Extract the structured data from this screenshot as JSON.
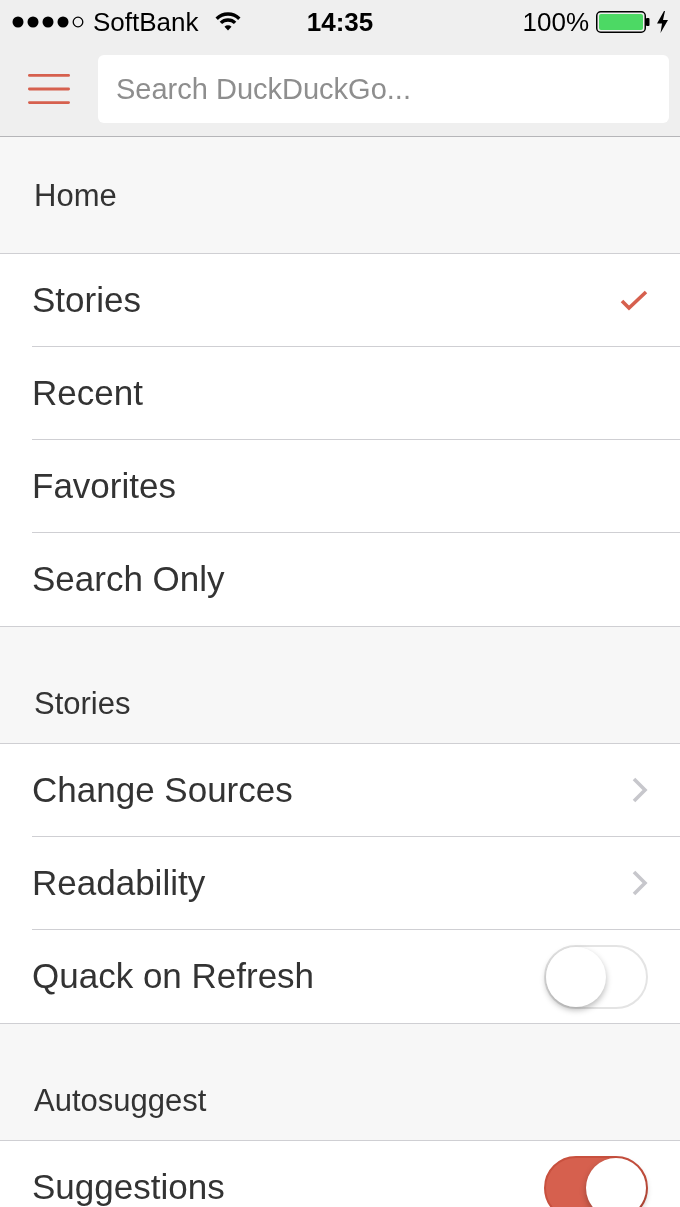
{
  "status_bar": {
    "carrier": "SoftBank",
    "time": "14:35",
    "battery": "100%"
  },
  "nav_bar": {
    "search": {
      "placeholder": "Search DuckDuckGo..."
    }
  },
  "sections": [
    {
      "header": "Home",
      "rows": [
        {
          "kind": "check",
          "label": "Stories",
          "selected": true
        },
        {
          "kind": "check",
          "label": "Recent",
          "selected": false
        },
        {
          "kind": "check",
          "label": "Favorites",
          "selected": false
        },
        {
          "kind": "check",
          "label": "Search Only",
          "selected": false
        }
      ]
    },
    {
      "header": "Stories",
      "rows": [
        {
          "kind": "link",
          "label": "Change Sources"
        },
        {
          "kind": "link",
          "label": "Readability"
        },
        {
          "kind": "switch",
          "label": "Quack on Refresh",
          "on": false
        }
      ]
    },
    {
      "header": "Autosuggest",
      "rows": [
        {
          "kind": "switch",
          "label": "Suggestions",
          "on": true
        }
      ]
    }
  ]
}
